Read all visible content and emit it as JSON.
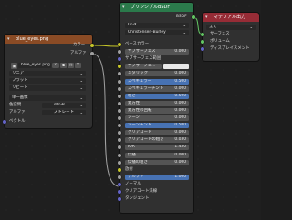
{
  "texture_node": {
    "title": "blue_eyes.png",
    "out_color": "カラー",
    "out_alpha": "アルファ",
    "image_name": "blue_eyes.png",
    "user_count": "2",
    "interpolation": "リニア",
    "projection": "フラット",
    "extension": "リピート",
    "source": "単一画像",
    "colorspace_label": "色空間",
    "colorspace_value": "sRGB",
    "alpha_label": "アルファ",
    "alpha_value": "ストレート",
    "in_vector": "ベクトル"
  },
  "bsdf_node": {
    "title": "プリンシプルBSDF",
    "out_bsdf": "BSDF",
    "distribution": "GGX",
    "subsurface_method": "Christensen-Burley",
    "inputs": [
      {
        "label": "ベースカラー",
        "value": ""
      },
      {
        "label": "サブサーフェス",
        "value": "0.000"
      },
      {
        "label": "サブサーフェス範囲",
        "value": ""
      },
      {
        "label": "サブサーフェ...",
        "value": ""
      },
      {
        "label": "メタリック",
        "value": "0.000"
      },
      {
        "label": "スペキュラー",
        "value": "0.500"
      },
      {
        "label": "スペキュラーチント",
        "value": "0.000"
      },
      {
        "label": "粗さ",
        "value": "0.500"
      },
      {
        "label": "異方性",
        "value": "0.000"
      },
      {
        "label": "異方性の回転",
        "value": "0.000"
      },
      {
        "label": "シーン",
        "value": "0.000"
      },
      {
        "label": "シーンチント",
        "value": "0.500"
      },
      {
        "label": "クリアコート",
        "value": "0.000"
      },
      {
        "label": "クリアコートの粗さ",
        "value": "0.030"
      },
      {
        "label": "IOR",
        "value": "1.450"
      },
      {
        "label": "伝播",
        "value": "0.000"
      },
      {
        "label": "伝播の粗さ",
        "value": "0.000"
      },
      {
        "label": "放射",
        "value": ""
      },
      {
        "label": "アルファ",
        "value": "1.000"
      },
      {
        "label": "ノーマル",
        "value": ""
      },
      {
        "label": "クリアコート法線",
        "value": ""
      },
      {
        "label": "タンジェント",
        "value": ""
      }
    ]
  },
  "output_node": {
    "title": "マテリアル出力",
    "target": "全て",
    "inputs": [
      "サーフェス",
      "ボリューム",
      "ディスプレイスメント"
    ]
  },
  "colors": {
    "texture_header": "#8a4b25",
    "bsdf_header": "#2b7a4b",
    "output_header": "#962c36",
    "wire": "#c7c729",
    "selected_field": "#4772b3"
  }
}
